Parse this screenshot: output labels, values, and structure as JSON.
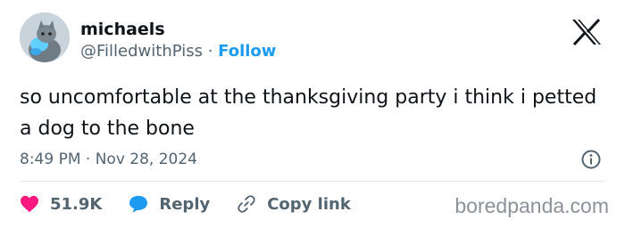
{
  "user": {
    "name": "michaels",
    "handle": "@FilledwithPiss",
    "separator": "·",
    "follow_label": "Follow"
  },
  "platform_icon": "x-logo-icon",
  "tweet": {
    "text": "so uncomfortable at the thanksgiving party i think i petted a dog to the bone",
    "timestamp": "8:49 PM · Nov 28, 2024"
  },
  "actions": {
    "like_count": "51.9K",
    "reply_label": "Reply",
    "copy_label": "Copy link"
  },
  "watermark": "boredpanda.com",
  "colors": {
    "accent": "#1d9bf0",
    "like": "#f91880",
    "text": "#0f1419",
    "muted": "#536471"
  }
}
